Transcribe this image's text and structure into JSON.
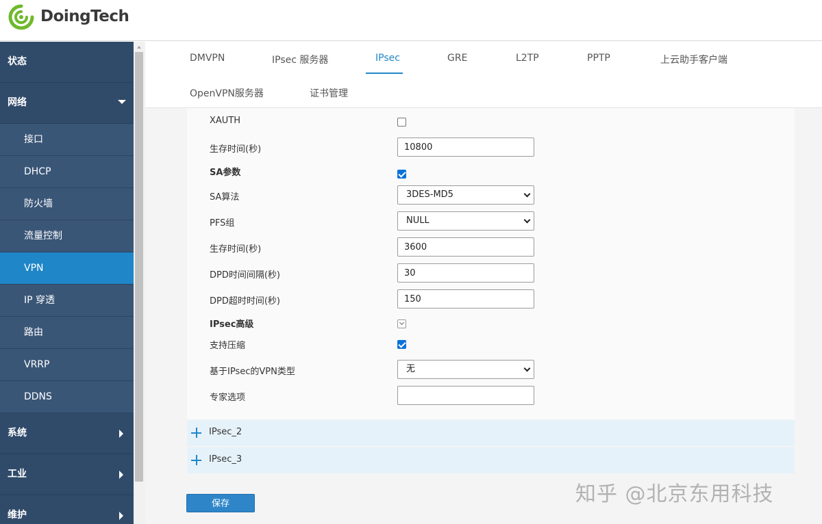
{
  "brand": {
    "name": "DoingTech",
    "color": "#6fb92c"
  },
  "sidebar": {
    "status": "状态",
    "network": "网络",
    "network_items": [
      "接口",
      "DHCP",
      "防火墙",
      "流量控制",
      "VPN",
      "IP 穿透",
      "路由",
      "VRRP",
      "DDNS"
    ],
    "active_item": "VPN",
    "system": "系统",
    "industry": "工业",
    "maintenance": "维护"
  },
  "tabs": {
    "row1": [
      "DMVPN",
      "IPsec 服务器",
      "IPsec",
      "GRE",
      "L2TP",
      "PPTP",
      "上云助手客户端"
    ],
    "row2": [
      "OpenVPN服务器",
      "证书管理"
    ],
    "active": "IPsec"
  },
  "form": {
    "xauth_label": "XAUTH",
    "xauth_checked": false,
    "lifetime1_label": "生存时间(秒)",
    "lifetime1_value": "10800",
    "sa_params_label": "SA参数",
    "sa_params_checked": true,
    "sa_algo_label": "SA算法",
    "sa_algo_value": "3DES-MD5",
    "pfs_label": "PFS组",
    "pfs_value": "NULL",
    "lifetime2_label": "生存时间(秒)",
    "lifetime2_value": "3600",
    "dpd_interval_label": "DPD时间间隔(秒)",
    "dpd_interval_value": "30",
    "dpd_timeout_label": "DPD超时时间(秒)",
    "dpd_timeout_value": "150",
    "ipsec_adv_label": "IPsec高级",
    "compress_label": "支持压缩",
    "compress_checked": true,
    "vpn_type_label": "基于IPsec的VPN类型",
    "vpn_type_value": "无",
    "expert_label": "专家选项",
    "expert_value": ""
  },
  "accordion": [
    "IPsec_2",
    "IPsec_3"
  ],
  "save_label": "保存",
  "watermark": "知乎 @北京东用科技",
  "colors": {
    "sidebar": "#304a6a",
    "active": "#1f86c8",
    "accent": "#2e86c9"
  }
}
